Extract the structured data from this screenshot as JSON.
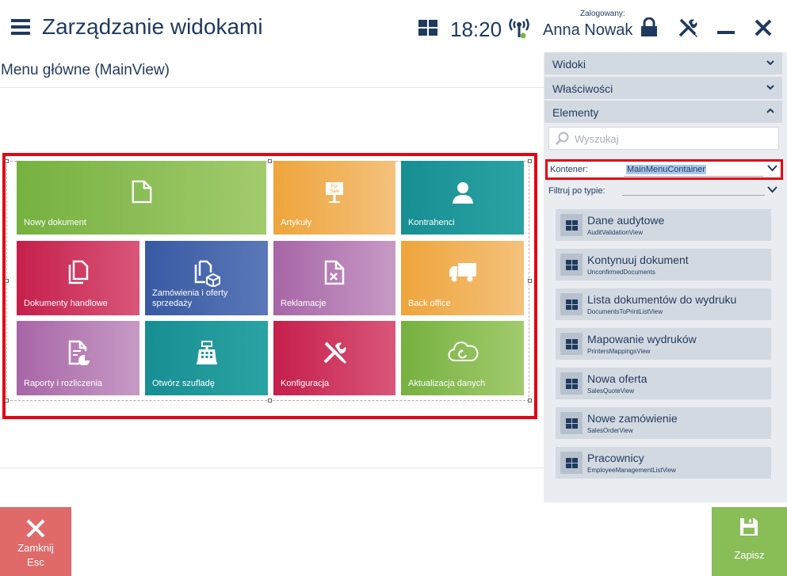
{
  "header": {
    "title": "Zarządzanie widokami",
    "time": "18:20",
    "logged_label": "Zalogowany:",
    "user": "Anna Nowak"
  },
  "view": {
    "title": "Menu główne (MainView)",
    "tiles": [
      {
        "label": "Nowy dokument",
        "icon": "document-icon",
        "color": "#7ab648"
      },
      {
        "label": "Artykuły",
        "icon": "for-sale-sign-icon",
        "color": "#f0a93e"
      },
      {
        "label": "Kontrahenci",
        "icon": "person-icon",
        "color": "#1c9396"
      },
      {
        "label": "Dokumenty handlowe",
        "icon": "documents-icon",
        "color": "#c8234f"
      },
      {
        "label": "Zamówienia i oferty sprzedaży",
        "icon": "order-box-icon",
        "color": "#3e5fa6"
      },
      {
        "label": "Reklamacje",
        "icon": "complaint-icon",
        "color": "#a96aa8"
      },
      {
        "label": "Back office",
        "icon": "truck-icon",
        "color": "#f0a93e"
      },
      {
        "label": "Raporty i rozliczenia",
        "icon": "report-icon",
        "color": "#a96aa8"
      },
      {
        "label": "Otwórz szufladę",
        "icon": "cash-register-icon",
        "color": "#1c9396"
      },
      {
        "label": "Konfiguracja",
        "icon": "tools-icon",
        "color": "#c8234f"
      },
      {
        "label": "Aktualizacja danych",
        "icon": "cloud-refresh-icon",
        "color": "#7ab648"
      }
    ]
  },
  "panel": {
    "sections": [
      "Widoki",
      "Właściwości",
      "Elementy"
    ],
    "search_placeholder": "Wyszukaj",
    "container_label": "Kontener:",
    "container_value": "MainMenuContainer",
    "filter_label": "Filtruj po typie:",
    "items": [
      {
        "name": "Dane audytowe",
        "id": "AuditValidationView"
      },
      {
        "name": "Kontynuuj dokument",
        "id": "UnconfirmedDocuments"
      },
      {
        "name": "Lista dokumentów do wydruku",
        "id": "DocumentsToPrintListView"
      },
      {
        "name": "Mapowanie wydruków",
        "id": "PrintersMappingsView"
      },
      {
        "name": "Nowa oferta",
        "id": "SalesQuoteView"
      },
      {
        "name": "Nowe zamówienie",
        "id": "SalesOrderView"
      },
      {
        "name": "Pracownicy",
        "id": "EmployeeManagementListView"
      }
    ]
  },
  "footer": {
    "close_label": "Zamknij",
    "close_key": "Esc",
    "save_label": "Zapisz"
  },
  "colors": {
    "accent": "#1f3a5f",
    "selection": "#e30613",
    "close": "#e06a6a",
    "save": "#89bd58"
  }
}
